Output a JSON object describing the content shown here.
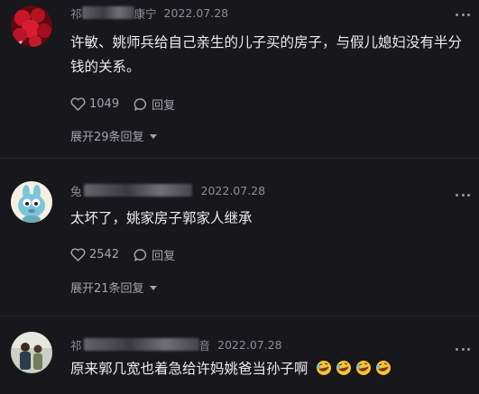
{
  "comments": [
    {
      "name_visible": "祁",
      "name_suffix": "康宁",
      "date": "2022.07.28",
      "text": "许敏、姚师兵给自己亲生的儿子买的房子，与假儿媳妇没有半分钱的关系。",
      "likes": "1049",
      "reply_label": "回复",
      "expand_label": "展开29条回复"
    },
    {
      "name_visible": "兔",
      "date": "2022.07.28",
      "text": "太坏了，姚家房子郭家人继承",
      "likes": "2542",
      "reply_label": "回复",
      "expand_label": "展开21条回复"
    },
    {
      "name_visible": "祁",
      "name_suffix": "音",
      "date": "2022.07.28",
      "text": "原来郭几宽也着急给许妈姚爸当孙子啊",
      "emoji": [
        "rolling-laugh-emoji",
        "rolling-laugh-emoji",
        "rolling-laugh-emoji",
        "rolling-laugh-emoji"
      ]
    }
  ],
  "colors": {
    "background": "#17171c",
    "text": "#ececf1",
    "meta": "#8e8e96"
  },
  "icons": {
    "like": "heart-outline-icon",
    "reply": "speech-bubble-icon",
    "more": "more-dots-icon",
    "expand": "triangle-down-icon"
  }
}
